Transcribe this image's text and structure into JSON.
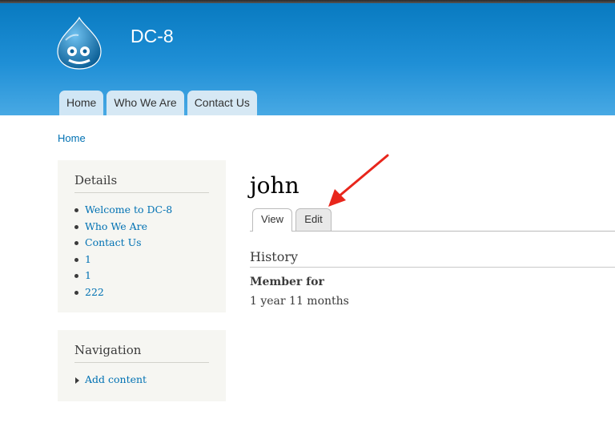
{
  "site": {
    "name": "DC-8",
    "logo": "drupal-drop-logo",
    "accent": "#0779bf"
  },
  "main_menu": [
    {
      "label": "Home"
    },
    {
      "label": "Who We Are"
    },
    {
      "label": "Contact Us"
    }
  ],
  "breadcrumb": {
    "home": "Home"
  },
  "sidebar": {
    "details": {
      "title": "Details",
      "items": [
        "Welcome to DC-8",
        "Who We Are",
        "Contact Us",
        "1",
        "1",
        "222"
      ]
    },
    "navigation": {
      "title": "Navigation",
      "items": [
        "Add content"
      ]
    }
  },
  "main": {
    "title": "john",
    "tabs": {
      "view": "View",
      "edit": "Edit"
    },
    "history": {
      "title": "History",
      "member_label": "Member for",
      "member_value": "1 year 11 months"
    }
  },
  "colors": {
    "link": "#0071b3",
    "arrow": "#e8261c",
    "sidebar_bg": "#f6f6f2"
  }
}
